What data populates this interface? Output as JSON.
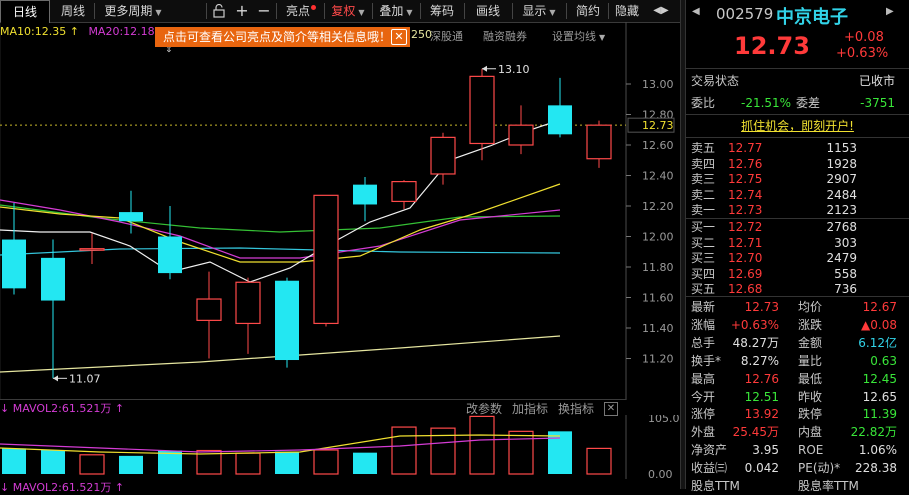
{
  "toolbar": {
    "tabs": [
      "日线",
      "周线",
      "更多周期"
    ],
    "highlights": "亮点",
    "fuquan": "复权",
    "overlay": "叠加",
    "chips": "筹码",
    "draw": "画线",
    "display": "显示",
    "simple": "简约",
    "hide": "隐藏",
    "plus": "+",
    "minus": "−"
  },
  "ma_legend": {
    "ma10": "MA10:12.35",
    "ma20": "MA20:12.18",
    "arrow": "↑"
  },
  "tooltip": {
    "text": "点击可查看公司亮点及简介等相关信息哦！"
  },
  "chart_links": {
    "ma250": "250",
    "deep_hk": "深股通",
    "margin": "融资融券",
    "set_ma": "设置均线"
  },
  "chart_data": {
    "type": "candlestick",
    "ylim": [
      11.07,
      13.2
    ],
    "y_ticks": [
      "13.00",
      "12.80",
      "12.73",
      "12.60",
      "12.40",
      "12.20",
      "12.00",
      "11.80",
      "11.60",
      "11.40",
      "11.20"
    ],
    "current_price": 12.73,
    "candles": [
      {
        "o": 11.98,
        "c": 11.66,
        "h": 12.22,
        "l": 11.62
      },
      {
        "o": 11.86,
        "c": 11.58,
        "h": 11.98,
        "l": 11.07
      },
      {
        "o": 11.92,
        "c": 11.92,
        "h": 12.02,
        "l": 11.82
      },
      {
        "o": 12.16,
        "c": 12.1,
        "h": 12.3,
        "l": 12.02
      },
      {
        "o": 12.0,
        "c": 11.76,
        "h": 12.2,
        "l": 11.72
      },
      {
        "o": 11.45,
        "c": 11.59,
        "h": 11.77,
        "l": 11.2
      },
      {
        "o": 11.43,
        "c": 11.7,
        "h": 11.73,
        "l": 11.23
      },
      {
        "o": 11.71,
        "c": 11.19,
        "h": 11.73,
        "l": 11.14
      },
      {
        "o": 11.43,
        "c": 12.27,
        "h": 12.27,
        "l": 11.41
      },
      {
        "o": 12.34,
        "c": 12.21,
        "h": 12.39,
        "l": 12.1
      },
      {
        "o": 12.23,
        "c": 12.36,
        "h": 12.37,
        "l": 12.18
      },
      {
        "o": 12.41,
        "c": 12.65,
        "h": 12.68,
        "l": 12.34
      },
      {
        "o": 12.61,
        "c": 13.05,
        "h": 13.1,
        "l": 12.5
      },
      {
        "o": 12.6,
        "c": 12.73,
        "h": 12.86,
        "l": 12.54
      },
      {
        "o": 12.86,
        "c": 12.67,
        "h": 13.04,
        "l": 12.65
      },
      {
        "o": 12.51,
        "c": 12.73,
        "h": 12.76,
        "l": 12.45
      }
    ],
    "annotations": [
      {
        "label": "13.10",
        "price": 13.1
      },
      {
        "label": "11.07",
        "price": 11.07
      }
    ],
    "volume": {
      "ylim": [
        0,
        105
      ],
      "y_ticks": [
        "105.00",
        "0.00"
      ],
      "values": [
        48,
        45,
        36,
        34,
        44,
        44,
        39,
        42,
        45,
        40,
        88,
        86,
        108,
        80,
        80,
        48
      ]
    }
  },
  "vol_header": {
    "left": "↓ MAVOL2:61.521万 ↑",
    "links": [
      "改参数",
      "加指标",
      "换指标"
    ],
    "close": "✕"
  },
  "vol2_header": {
    "text": "↓ MAVOL2:61.521万 ↑"
  },
  "quote": {
    "code": "002579",
    "name": "中京电子",
    "price": "12.73",
    "change": "+0.08",
    "change_pct": "+0.63%",
    "status_label": "交易状态",
    "status_value": "已收市",
    "weibi_label": "委比",
    "weibi_value": "-21.51%",
    "weicha_label": "委差",
    "weicha_value": "-3751",
    "promo": "抓住机会，即刻开户!",
    "sells": [
      {
        "label": "卖五",
        "price": "12.77",
        "vol": "1153"
      },
      {
        "label": "卖四",
        "price": "12.76",
        "vol": "1928"
      },
      {
        "label": "卖三",
        "price": "12.75",
        "vol": "2907"
      },
      {
        "label": "卖二",
        "price": "12.74",
        "vol": "2484"
      },
      {
        "label": "卖一",
        "price": "12.73",
        "vol": "2123"
      }
    ],
    "buys": [
      {
        "label": "买一",
        "price": "12.72",
        "vol": "2768"
      },
      {
        "label": "买二",
        "price": "12.71",
        "vol": "303"
      },
      {
        "label": "买三",
        "price": "12.70",
        "vol": "2479"
      },
      {
        "label": "买四",
        "price": "12.69",
        "vol": "558"
      },
      {
        "label": "买五",
        "price": "12.68",
        "vol": "736"
      }
    ],
    "stats": [
      {
        "l1": "最新",
        "v1": "12.73",
        "c1": "red",
        "l2": "均价",
        "v2": "12.67",
        "c2": "red"
      },
      {
        "l1": "涨幅",
        "v1": "+0.63%",
        "c1": "red",
        "l2": "涨跌",
        "v2": "▲0.08",
        "c2": "red"
      },
      {
        "l1": "总手",
        "v1": "48.27万",
        "c1": "wht",
        "l2": "金额",
        "v2": "6.12亿",
        "c2": "cyan"
      },
      {
        "l1": "换手*",
        "v1": "8.27%",
        "c1": "wht",
        "l2": "量比",
        "v2": "0.63",
        "c2": "grn"
      },
      {
        "l1": "最高",
        "v1": "12.76",
        "c1": "red",
        "l2": "最低",
        "v2": "12.45",
        "c2": "grn"
      },
      {
        "l1": "今开",
        "v1": "12.51",
        "c1": "grn",
        "l2": "昨收",
        "v2": "12.65",
        "c2": "wht"
      },
      {
        "l1": "涨停",
        "v1": "13.92",
        "c1": "red",
        "l2": "跌停",
        "v2": "11.39",
        "c2": "grn"
      },
      {
        "l1": "外盘",
        "v1": "25.45万",
        "c1": "red",
        "l2": "内盘",
        "v2": "22.82万",
        "c2": "grn"
      },
      {
        "l1": "净资产",
        "v1": "3.95",
        "c1": "wht",
        "l2": "ROE",
        "v2": "1.06%",
        "c2": "wht"
      },
      {
        "l1": "收益㈢",
        "v1": "0.042",
        "c1": "wht",
        "l2": "PE(动)*",
        "v2": "228.38",
        "c2": "wht"
      },
      {
        "l1": "股息TTM",
        "v1": "",
        "c1": "wht",
        "l2": "股息率TTM",
        "v2": "",
        "c2": "wht"
      }
    ]
  }
}
